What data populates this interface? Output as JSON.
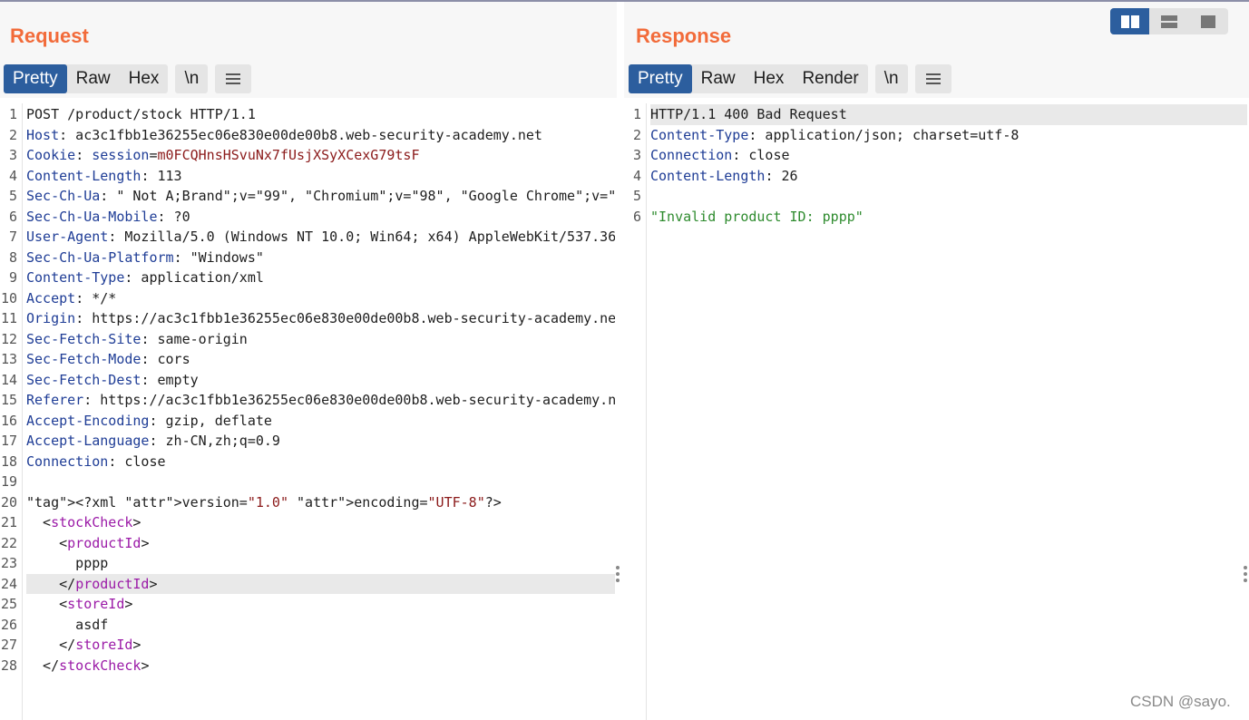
{
  "request": {
    "title": "Request",
    "tabs": [
      "Pretty",
      "Raw",
      "Hex"
    ],
    "newline_label": "\\n",
    "menu_icon": "hamburger-icon",
    "lines": [
      "POST /product/stock HTTP/1.1",
      "Host: ac3c1fbb1e36255ec06e830e00de00b8.web-security-academy.net",
      "Cookie: session=m0FCQHnsHSvuNx7fUsjXSyXCexG79tsF",
      "Content-Length: 113",
      "Sec-Ch-Ua: \" Not A;Brand\";v=\"99\", \"Chromium\";v=\"98\", \"Google Chrome\";v=\"",
      "Sec-Ch-Ua-Mobile: ?0",
      "User-Agent: Mozilla/5.0 (Windows NT 10.0; Win64; x64) AppleWebKit/537.36",
      "Sec-Ch-Ua-Platform: \"Windows\"",
      "Content-Type: application/xml",
      "Accept: */*",
      "Origin: https://ac3c1fbb1e36255ec06e830e00de00b8.web-security-academy.ne",
      "Sec-Fetch-Site: same-origin",
      "Sec-Fetch-Mode: cors",
      "Sec-Fetch-Dest: empty",
      "Referer: https://ac3c1fbb1e36255ec06e830e00de00b8.web-security-academy.n",
      "Accept-Encoding: gzip, deflate",
      "Accept-Language: zh-CN,zh;q=0.9",
      "Connection: close",
      "",
      "<?xml version=\"1.0\" encoding=\"UTF-8\"?>",
      "  <stockCheck>",
      "    <productId>",
      "      pppp",
      "    </productId>",
      "    <storeId>",
      "      asdf",
      "    </storeId>",
      "  </stockCheck>"
    ]
  },
  "response": {
    "title": "Response",
    "tabs": [
      "Pretty",
      "Raw",
      "Hex",
      "Render"
    ],
    "newline_label": "\\n",
    "menu_icon": "hamburger-icon",
    "lines": [
      "HTTP/1.1 400 Bad Request",
      "Content-Type: application/json; charset=utf-8",
      "Connection: close",
      "Content-Length: 26",
      "",
      "\"Invalid product ID: pppp\""
    ]
  },
  "layout_buttons": [
    "split-horizontal-icon",
    "split-vertical-icon",
    "single-pane-icon"
  ],
  "watermark": "CSDN @sayo.",
  "colors": {
    "title": "#f26b3a",
    "active_tab": "#2c5e9e",
    "header_key": "#1f3d96",
    "cookie_value": "#8b1a1a",
    "xml_tag": "#9b1aa7",
    "string": "#2e8b2e"
  }
}
